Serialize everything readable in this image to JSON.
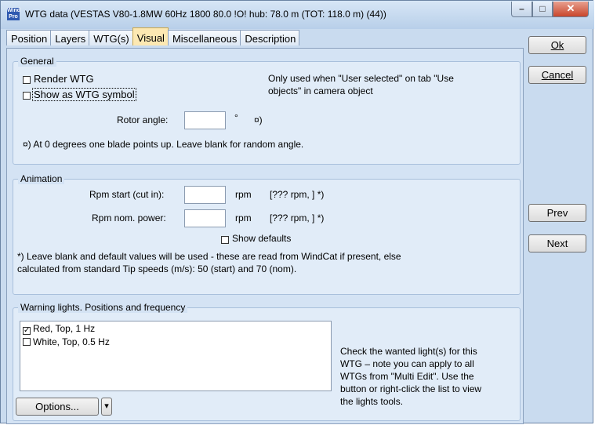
{
  "window": {
    "title": "WTG data   (VESTAS V80-1.8MW  60Hz 1800 80.0 !O! hub: 78.0 m (TOT: 118.0 m) (44))",
    "icon_text": "Wind Pro",
    "min_glyph": "–",
    "max_glyph": "□",
    "close_glyph": "✕"
  },
  "tabs": [
    {
      "label": "Position",
      "active": false
    },
    {
      "label": "Layers",
      "active": false
    },
    {
      "label": "WTG(s)",
      "active": false
    },
    {
      "label": "Visual",
      "active": true
    },
    {
      "label": "Miscellaneous",
      "active": false
    },
    {
      "label": "Description",
      "active": false
    }
  ],
  "general": {
    "legend": "General",
    "render_wtg": {
      "label": "Render WTG",
      "checked": false
    },
    "show_symbol": {
      "label": "Show as WTG symbol",
      "checked": false
    },
    "note_line1": "Only used when \"User selected\" on tab \"Use",
    "note_line2": "objects\" in camera object",
    "rotor_label": "Rotor angle:",
    "rotor_value": "",
    "rotor_unit": "°",
    "rotor_mark": "¤)",
    "rotor_footnote": "¤) At 0 degrees one blade points up. Leave blank for random angle."
  },
  "animation": {
    "legend": "Animation",
    "rpm_start_label": "Rpm start (cut in):",
    "rpm_start_value": "",
    "rpm_start_unit": "rpm",
    "rpm_start_hint": "[??? rpm, ] *)",
    "rpm_nom_label": "Rpm nom. power:",
    "rpm_nom_value": "",
    "rpm_nom_unit": "rpm",
    "rpm_nom_hint": "[??? rpm, ] *)",
    "show_defaults": {
      "label": "Show defaults",
      "checked": false
    },
    "footnote_line1": "*) Leave blank and default values will be used - these are read from WindCat if present, else",
    "footnote_line2": "calculated from standard Tip speeds (m/s): 50 (start) and 70 (nom)."
  },
  "warning": {
    "legend": "Warning lights. Positions and frequency",
    "items": [
      {
        "label": "Red, Top, 1 Hz",
        "checked": true
      },
      {
        "label": "White, Top, 0.5 Hz",
        "checked": false
      }
    ],
    "help_lines": [
      "Check the wanted light(s) for this",
      "WTG – note you can apply to all",
      "WTGs from \"Multi Edit\". Use the",
      "button or right-click the list to view",
      "the lights tools."
    ],
    "options_label": "Options...",
    "dropdown_glyph": "▾"
  },
  "buttons": {
    "ok_label": "Ok",
    "cancel_label": "Cancel",
    "prev_label": "Prev",
    "next_label": "Next"
  }
}
